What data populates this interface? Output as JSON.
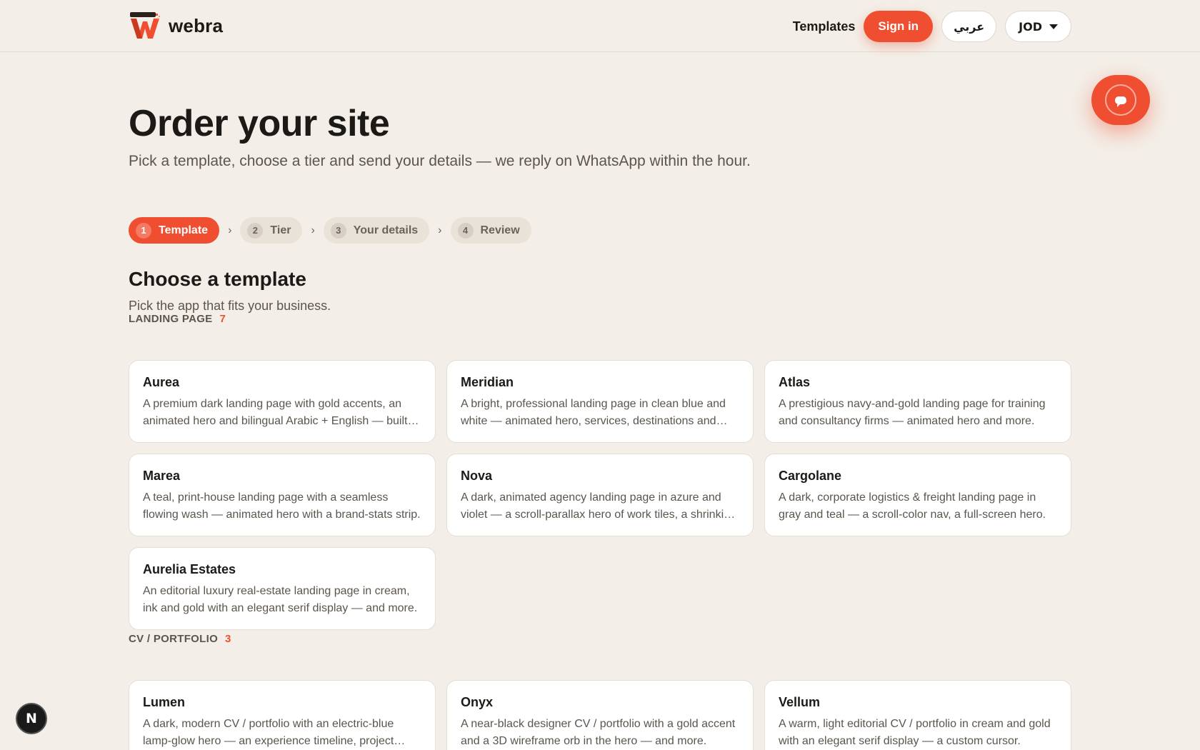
{
  "brand": {
    "name": "webra",
    "logo_icon": "webra-w-logo-icon",
    "accent": "#f04e30"
  },
  "nav": {
    "templates_link": "Templates",
    "sign_in": "Sign in",
    "language": "عربي",
    "currency": "JOD"
  },
  "chat_fab": {
    "icon": "chat-bubble-icon"
  },
  "hero": {
    "title": "Order your site",
    "subtitle": "Pick a template, choose a tier and send your details — we reply on WhatsApp within the hour."
  },
  "steps": [
    {
      "num": "1",
      "label": "Template",
      "active": true
    },
    {
      "num": "2",
      "label": "Tier",
      "active": false
    },
    {
      "num": "3",
      "label": "Your details",
      "active": false
    },
    {
      "num": "4",
      "label": "Review",
      "active": false
    }
  ],
  "step_separator": "›",
  "section": {
    "title": "Choose a template",
    "subtitle": "Pick the app that fits your business."
  },
  "groups": [
    {
      "label": "LANDING PAGE",
      "count": "7",
      "templates": [
        {
          "name": "Aurea",
          "desc": "A premium dark landing page with gold accents, an animated hero and bilingual Arabic + English — built for high-end brands."
        },
        {
          "name": "Meridian",
          "desc": "A bright, professional landing page in clean blue and white — animated hero, services, destinations and more."
        },
        {
          "name": "Atlas",
          "desc": "A prestigious navy-and-gold landing page for training and consultancy firms — animated hero and more."
        },
        {
          "name": "Marea",
          "desc": "A teal, print-house landing page with a seamless flowing wash — animated hero with a brand-stats strip."
        },
        {
          "name": "Nova",
          "desc": "A dark, animated agency landing page in azure and violet — a scroll-parallax hero of work tiles, a shrinking nav."
        },
        {
          "name": "Cargolane",
          "desc": "A dark, corporate logistics & freight landing page in gray and teal — a scroll-color nav, a full-screen hero."
        },
        {
          "name": "Aurelia Estates",
          "desc": "An editorial luxury real-estate landing page in cream, ink and gold with an elegant serif display — and more."
        }
      ]
    },
    {
      "label": "CV / PORTFOLIO",
      "count": "3",
      "templates": [
        {
          "name": "Lumen",
          "desc": "A dark, modern CV / portfolio with an electric-blue lamp-glow hero — an experience timeline, project showcase."
        },
        {
          "name": "Onyx",
          "desc": "A near-black designer CV / portfolio with a gold accent and a 3D wireframe orb in the hero — and more."
        },
        {
          "name": "Vellum",
          "desc": "A warm, light editorial CV / portfolio in cream and gold with an elegant serif display — a custom cursor."
        }
      ]
    }
  ],
  "dev_badge": "N"
}
